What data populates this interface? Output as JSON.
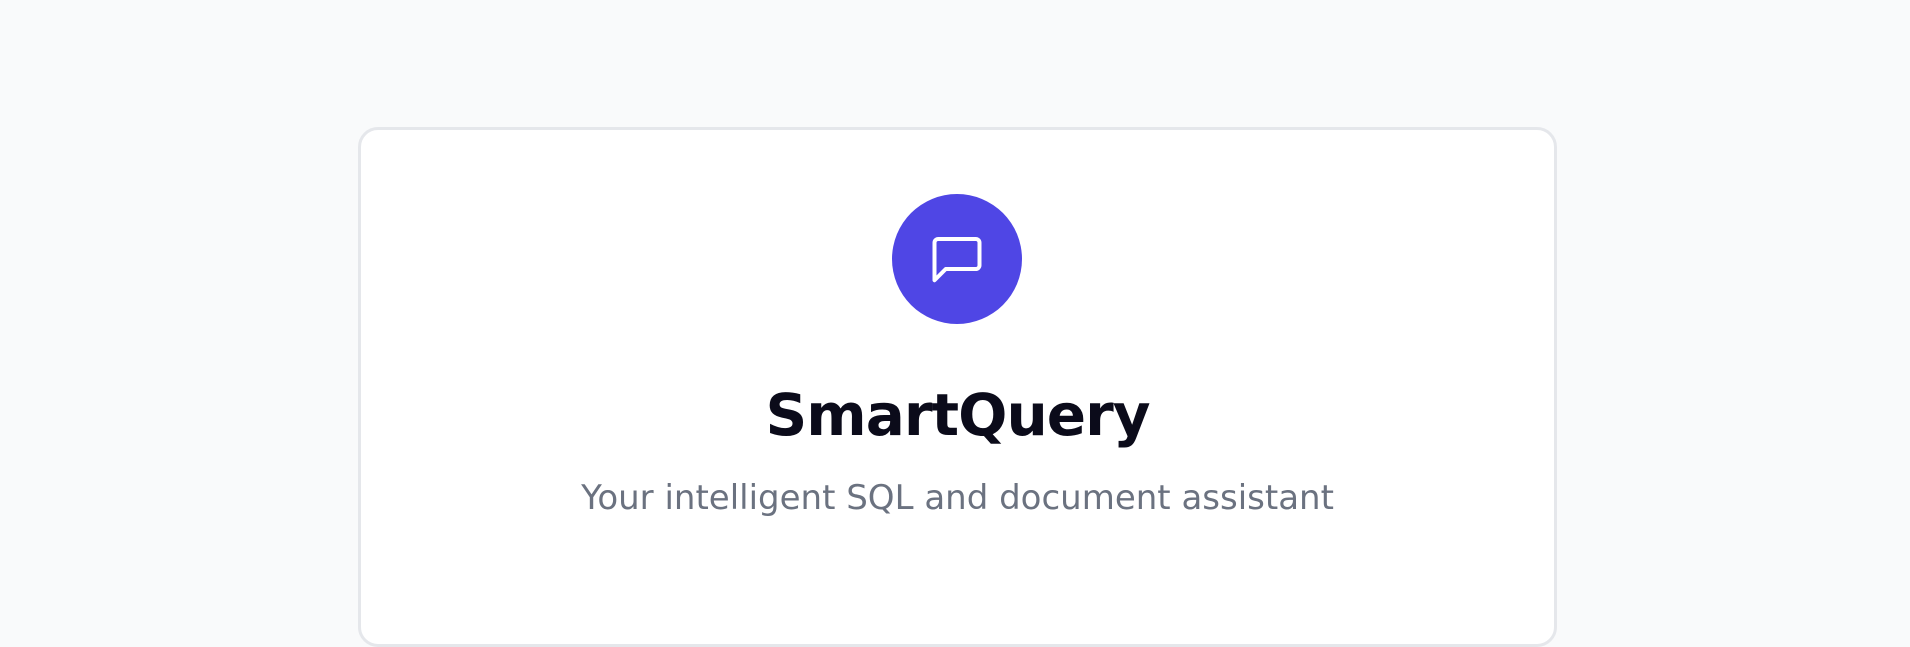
{
  "app": {
    "title": "SmartQuery",
    "subtitle": "Your intelligent SQL and document assistant"
  },
  "logo": {
    "icon": "chat-bubble-icon",
    "background_color": "#4f46e5",
    "icon_color": "#ffffff"
  }
}
